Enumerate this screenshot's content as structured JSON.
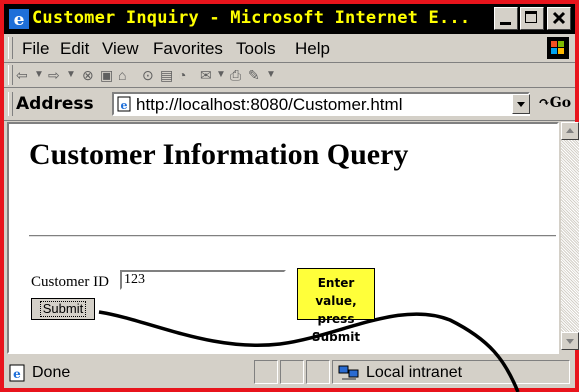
{
  "window": {
    "title": "Customer Inquiry - Microsoft Internet E...",
    "frame_color": "#e8141c",
    "title_color": "#ffff00"
  },
  "menu": {
    "items": [
      {
        "label": "File"
      },
      {
        "label": "Edit"
      },
      {
        "label": "View"
      },
      {
        "label": "Favorites"
      },
      {
        "label": "Tools"
      },
      {
        "label": "Help"
      }
    ]
  },
  "address": {
    "label": "Address",
    "url": "http://localhost:8080/Customer.html",
    "go_label": "Go"
  },
  "page": {
    "heading": "Customer Information Query",
    "customer_id_label": "Customer ID",
    "customer_id_value": "123",
    "submit_label": "Submit"
  },
  "callout": {
    "line1": "Enter value,",
    "line2": "press Submit",
    "color": "#ffff3a"
  },
  "status": {
    "text": "Done",
    "zone": "Local intranet"
  }
}
